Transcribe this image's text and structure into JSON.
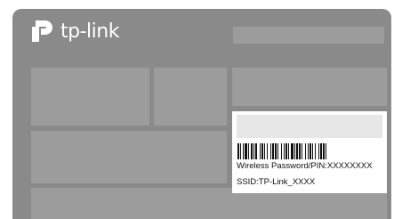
{
  "brand": {
    "name": "tp-link",
    "logo_icon": "tp-link-logo-icon"
  },
  "wireless_info": {
    "password_line": "Wireless Password/PIN:XXXXXXXX",
    "ssid_line": "SSID:TP-Link_XXXX"
  },
  "colors": {
    "card": "#8a8a8a",
    "block": "#9c9c9c",
    "panel": "#ffffff",
    "panel_box": "#e6e6e6"
  }
}
